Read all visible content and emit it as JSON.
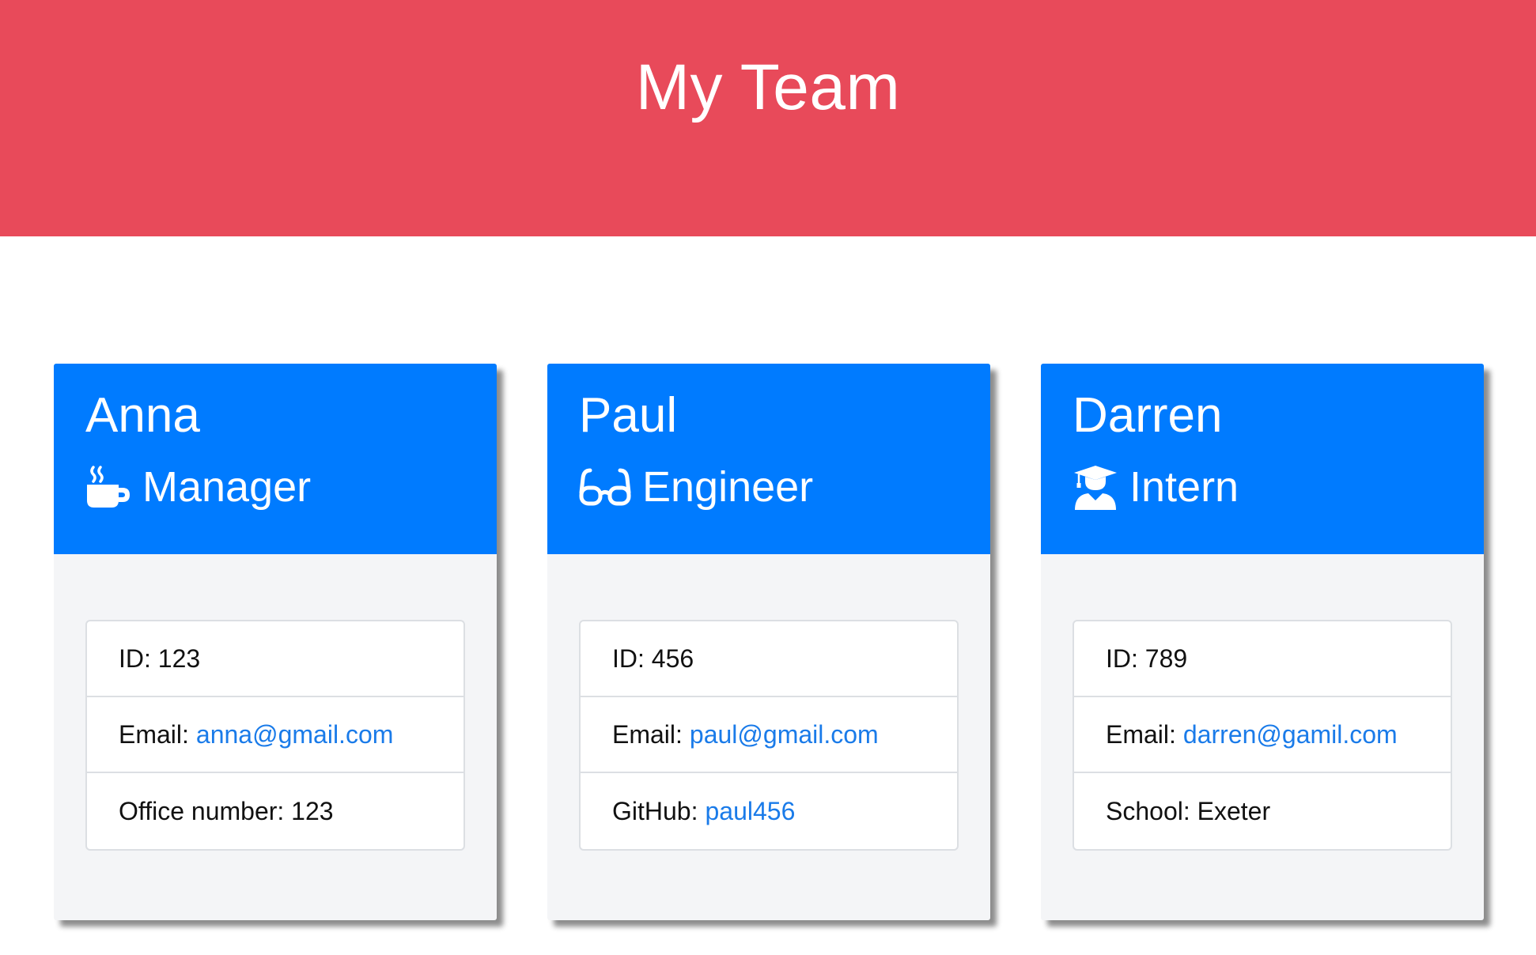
{
  "header": {
    "title": "My Team"
  },
  "colors": {
    "header_bg": "#e84a5a",
    "card_header_bg": "#007bff",
    "link": "#1a7be9"
  },
  "cards": [
    {
      "name": "Anna",
      "role": "Manager",
      "role_icon": "coffee-mug-icon",
      "id_text": "ID: 123",
      "email_label": "Email:",
      "email": "anna@gmail.com",
      "extra_label": "Office number: 123",
      "extra_link": ""
    },
    {
      "name": "Paul",
      "role": "Engineer",
      "role_icon": "glasses-icon",
      "id_text": "ID: 456",
      "email_label": "Email:",
      "email": "paul@gmail.com",
      "extra_label": "GitHub:",
      "extra_link": "paul456"
    },
    {
      "name": "Darren",
      "role": "Intern",
      "role_icon": "graduate-icon",
      "id_text": "ID: 789",
      "email_label": "Email:",
      "email": "darren@gamil.com",
      "extra_label": "School: Exeter",
      "extra_link": ""
    }
  ]
}
